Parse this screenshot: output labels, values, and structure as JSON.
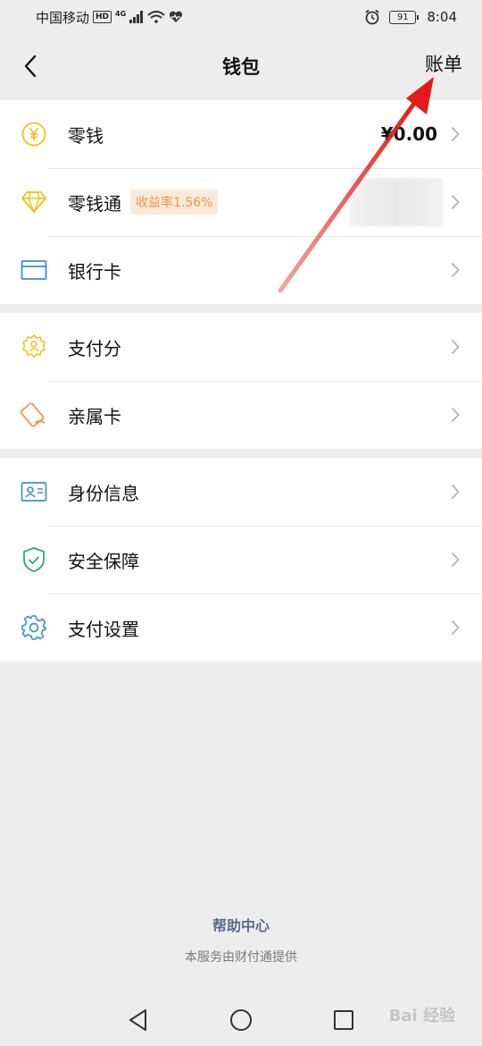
{
  "status_bar": {
    "carrier": "中国移动",
    "hd": "HD",
    "network": "4G",
    "battery": "91",
    "time": "8:04"
  },
  "nav": {
    "title": "钱包",
    "action": "账单"
  },
  "groups": [
    {
      "items": [
        {
          "label": "零钱",
          "icon": "yuan-coin-icon",
          "value": "¥0.00"
        },
        {
          "label": "零钱通",
          "icon": "diamond-icon",
          "badge": "收益率1.56%"
        },
        {
          "label": "银行卡",
          "icon": "bank-card-icon"
        }
      ]
    },
    {
      "items": [
        {
          "label": "支付分",
          "icon": "pay-score-icon"
        },
        {
          "label": "亲属卡",
          "icon": "family-card-icon"
        }
      ]
    },
    {
      "items": [
        {
          "label": "身份信息",
          "icon": "id-card-icon"
        },
        {
          "label": "安全保障",
          "icon": "shield-icon"
        },
        {
          "label": "支付设置",
          "icon": "gear-icon"
        }
      ]
    }
  ],
  "footer": {
    "help": "帮助中心",
    "provider": "本服务由财付通提供"
  },
  "watermark": "Bai 经验",
  "colors": {
    "background": "#ededed",
    "yellow_icon": "#f2c21b",
    "blue_icon": "#3b8fd1",
    "green_icon": "#2aae67",
    "orange_icon": "#e8964a",
    "badge_bg": "#fbeadb",
    "annotation_arrow": "#e11b1b"
  }
}
